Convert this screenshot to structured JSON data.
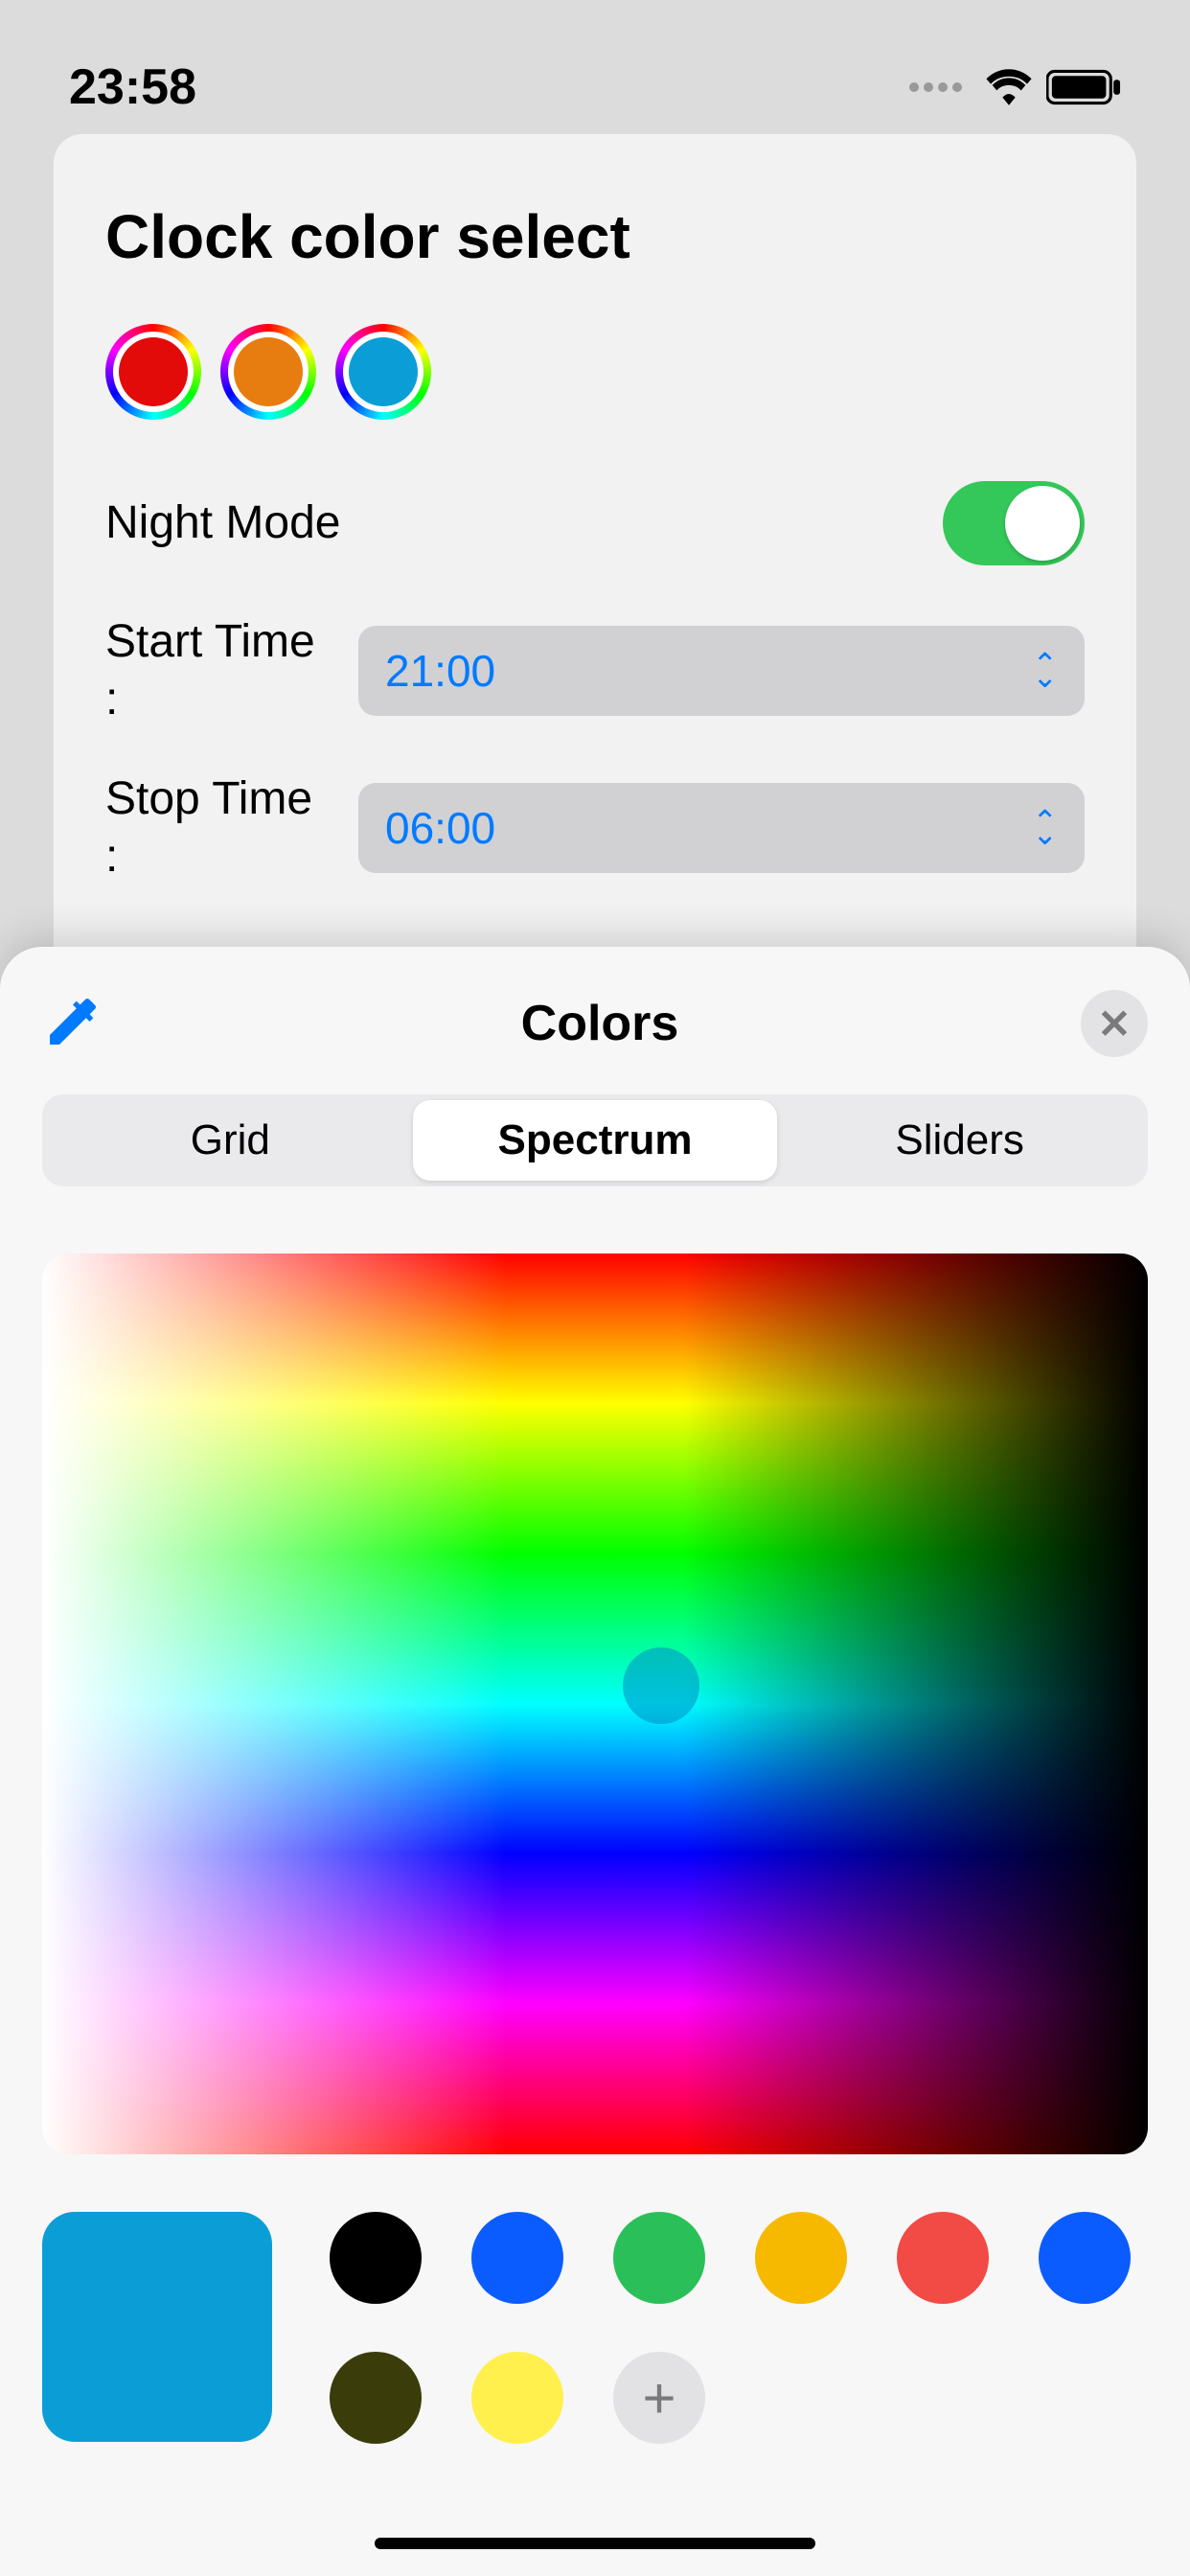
{
  "status": {
    "time": "23:58"
  },
  "settings": {
    "title": "Clock color select",
    "swatches": [
      "#e30a0a",
      "#e77c11",
      "#0b9dd6"
    ],
    "night_mode_label": "Night Mode",
    "night_mode_on": true,
    "start_label": "Start Time :",
    "start_value": "21:00",
    "stop_label": "Stop Time :",
    "stop_value": "06:00"
  },
  "picker": {
    "title": "Colors",
    "tabs": [
      "Grid",
      "Spectrum",
      "Sliders"
    ],
    "active_tab": "Spectrum",
    "current_color": "#0b9dd6",
    "palette": [
      "#000000",
      "#0a5cff",
      "#2bbf5a",
      "#f6b900",
      "#f24a45",
      "#0a5cff",
      "#3a3d0a",
      "#fff04d"
    ],
    "add_label": "+"
  }
}
